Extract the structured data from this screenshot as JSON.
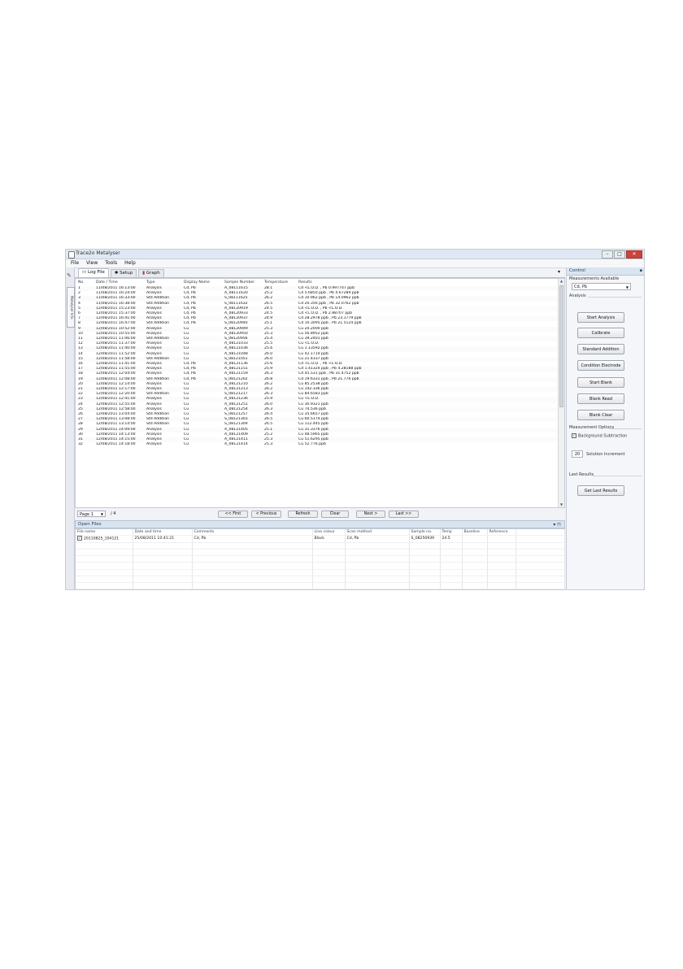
{
  "page_number": "",
  "window": {
    "title": "Trace2o Metalyser",
    "buttons": [
      "–",
      "□",
      "✕"
    ]
  },
  "menu": [
    "File",
    "View",
    "Tools",
    "Help"
  ],
  "left_toolbar": {
    "vertical_tab": "Metalyser Info"
  },
  "tabs": [
    {
      "label": "Log File",
      "icon": "page-icon"
    },
    {
      "label": "Setup",
      "icon": "wrench-icon"
    },
    {
      "label": "Graph",
      "icon": "bar-chart-icon"
    }
  ],
  "log_table": {
    "columns": [
      "No.",
      "Date / Time",
      "Type",
      "Display Name",
      "Sample Number",
      "Temperature",
      "Results"
    ],
    "rows": [
      [
        "1",
        "11/08/2011 16:13:00",
        "Analysis",
        "Cd, Pb",
        "A_08111615",
        "28.1",
        "Cd <L.O.D. , Pb 0.997747 ppb"
      ],
      [
        "2",
        "11/08/2011 16:24:00",
        "Analysis",
        "Cd, Pb",
        "A_08111620",
        "25.2",
        "Cd 5.6850 ppb , Pb 4.67289 ppb"
      ],
      [
        "3",
        "11/08/2011 16:33:00",
        "Std Addition",
        "Cd, Pb",
        "S_08111625",
        "26.2",
        "Cd 10.962 ppb , Pb 14.0962 ppb"
      ],
      [
        "4",
        "11/08/2011 16:38:00",
        "Std Addition",
        "Cd, Pb",
        "S_08111632",
        "26.5",
        "Cd 20.356 ppb , Pb 32.0762 ppb"
      ],
      [
        "5",
        "12/08/2011 15:23:00",
        "Analysis",
        "Cd, Pb",
        "A_08120919",
        "24.5",
        "Cd <L.O.D. , Pb <L.O.D."
      ],
      [
        "6",
        "12/08/2011 15:37:00",
        "Analysis",
        "Cd, Pb",
        "A_08120933",
        "24.5",
        "Cd <L.O.D. , Pb 2.88707 ppb"
      ],
      [
        "7",
        "12/08/2011 16:41:00",
        "Analysis",
        "Cd, Pb",
        "A_08120937",
        "24.9",
        "Cd 28.2978 ppb , Pb 23.1779 ppb"
      ],
      [
        "8",
        "12/08/2011 16:47:00",
        "Std Addition",
        "Cd, Pb",
        "S_08120940",
        "25.1",
        "Cd 10.3095 ppb , Pb 21.5124 ppb"
      ],
      [
        "9",
        "12/08/2011 10:52:00",
        "Analysis",
        "Cu",
        "A_08120949",
        "25.3",
        "Cu 20.2000 ppb"
      ],
      [
        "10",
        "12/08/2011 10:55:00",
        "Analysis",
        "Cu",
        "A_08120950",
        "25.3",
        "Cu 56.8952 ppb"
      ],
      [
        "11",
        "12/08/2011 11:06:00",
        "Std Addition",
        "Cu",
        "S_08120956",
        "25.4",
        "Cu 39.2401 ppb"
      ],
      [
        "12",
        "12/08/2011 11:37:00",
        "Analysis",
        "Cu",
        "A_08121033",
        "25.5",
        "Cu <L.O.D."
      ],
      [
        "13",
        "12/08/2011 11:40:00",
        "Analysis",
        "Cu",
        "A_08121036",
        "25.6",
        "Cu 1.13592 ppb"
      ],
      [
        "14",
        "12/08/2011 11:52:00",
        "Analysis",
        "Cu",
        "A_08121048",
        "26.0",
        "Cu 42.1714 ppb"
      ],
      [
        "15",
        "12/08/2011 11:58:00",
        "Std Addition",
        "Cu",
        "S_08121051",
        "26.0",
        "Cu 21.4337 ppb"
      ],
      [
        "16",
        "12/08/2011 11:41:00",
        "Analysis",
        "Cd, Pb",
        "A_08121136",
        "25.6",
        "Cd <L.O.D. , Pb <L.O.D."
      ],
      [
        "17",
        "12/08/2011 11:55:00",
        "Analysis",
        "Cd, Pb",
        "A_08121151",
        "25.9",
        "Cd 1.41324 ppb , Pb 4.28188 ppb"
      ],
      [
        "18",
        "12/08/2011 12:04:00",
        "Analysis",
        "Cd, Pb",
        "A_08121159",
        "26.3",
        "Cd 45.531 ppb , Pb 31.4752 ppb"
      ],
      [
        "19",
        "12/08/2011 12:08:00",
        "Std Addition",
        "Cd, Pb",
        "S_08121202",
        "26.8",
        "Cd 19.6331 ppb , Pb 21.776 ppb"
      ],
      [
        "20",
        "12/08/2011 12:14:00",
        "Analysis",
        "Cu",
        "A_08121210",
        "26.2",
        "Cu 85.2538 ppb"
      ],
      [
        "21",
        "12/08/2011 12:17:00",
        "Analysis",
        "Cu",
        "A_08121213",
        "26.2",
        "Cu 142.336 ppb"
      ],
      [
        "22",
        "12/08/2011 12:20:00",
        "Std Addition",
        "Cu",
        "S_08121217",
        "26.3",
        "Cu 84.6583 ppb"
      ],
      [
        "23",
        "12/08/2011 12:41:00",
        "Analysis",
        "Cu",
        "A_08121236",
        "25.9",
        "Cu <L.O.D."
      ],
      [
        "24",
        "12/08/2011 12:55:00",
        "Analysis",
        "Cu",
        "A_08121251",
        "26.0",
        "Cu 30.9321 ppb"
      ],
      [
        "25",
        "12/08/2011 12:58:00",
        "Analysis",
        "Cu",
        "A_08121254",
        "26.3",
        "Cu 74.536 ppb"
      ],
      [
        "26",
        "12/08/2011 13:04:00",
        "Std Addition",
        "Cu",
        "S_08121257",
        "26.4",
        "Cu 35.6657 ppb"
      ],
      [
        "27",
        "12/08/2011 13:08:00",
        "Std Addition",
        "Cu",
        "S_08121303",
        "26.5",
        "Cu 60.5174 ppb"
      ],
      [
        "28",
        "12/08/2011 13:14:00",
        "Std Addition",
        "Cu",
        "S_08121309",
        "26.5",
        "Cu 112.445 ppb"
      ],
      [
        "29",
        "12/08/2011 14:09:00",
        "Analysis",
        "Cu",
        "A_08121405",
        "25.1",
        "Cu 31.3376 ppb"
      ],
      [
        "30",
        "12/08/2011 14:13:00",
        "Analysis",
        "Cu",
        "A_08121409",
        "25.2",
        "Cu 48.5965 ppb"
      ],
      [
        "31",
        "12/08/2011 14:15:00",
        "Analysis",
        "Cu",
        "A_08121411",
        "25.3",
        "Cu 51.6295 ppb"
      ],
      [
        "32",
        "12/08/2011 14:18:00",
        "Analysis",
        "Cu",
        "A_08121414",
        "25.3",
        "Cu 52.776 ppb"
      ]
    ]
  },
  "pager": {
    "page_select": "Page 1",
    "page_total": "/ 4",
    "buttons": {
      "first": "<< First",
      "previous": "< Previous",
      "refresh": "Refresh",
      "clear": "Clear",
      "next": "Next >",
      "last": "Last >>"
    }
  },
  "open_files": {
    "title": "Open Files",
    "columns": [
      "File name",
      "Date and time",
      "Comments",
      "Line colour",
      "Scan method",
      "Sample no.",
      "Temp",
      "Baseline",
      "Reference"
    ],
    "rows": [
      [
        "20110825_104121",
        "25/08/2011 10:41:21",
        "Cd, Pb",
        "Black",
        "Cd, Pb",
        "S_08250939",
        "24.5",
        "",
        ""
      ]
    ]
  },
  "control": {
    "title": "Control",
    "measurements_label": "Measurements Available",
    "measurements_value": "Cd, Pb",
    "analysis_label": "Analysis",
    "buttons": [
      "Start Analysis",
      "Calibrate",
      "Standard Addition",
      "Condition Electrode",
      "Start Blank",
      "Blank Read",
      "Blank Clear"
    ],
    "options_label": "Measurement Options",
    "background_subtraction": "Background Subtraction",
    "solution_increment_value": "20",
    "solution_increment_label": "Solution Increment",
    "last_results_label": "Last Results",
    "get_last_results": "Get Last Results"
  }
}
